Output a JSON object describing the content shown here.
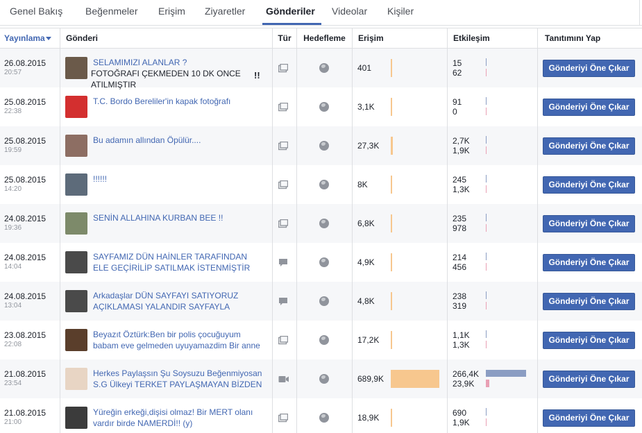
{
  "tabs": [
    "Genel Bakış",
    "Beğenmeler",
    "Erişim",
    "Ziyaretler",
    "Gönderiler",
    "Videolar",
    "Kişiler"
  ],
  "active_tab": "Gönderiler",
  "columns": {
    "published": "Yayınlama",
    "post": "Gönderi",
    "type": "Tür",
    "targeting": "Hedefleme",
    "reach": "Erişim",
    "engagement": "Etkileşim",
    "promote": "Tanıtımını Yap"
  },
  "promote_label": "Gönderiyi Öne Çıkar",
  "max_reach": 689900,
  "max_engagement": 266400,
  "colors": {
    "accent": "#4267b2",
    "reach_bar": "#f7c78e",
    "engagement_bar": "#8b9dc3",
    "reaction_bar": "#e9a0b4"
  },
  "posts": [
    {
      "date": "26.08.2015",
      "time": "20:57",
      "text": "SELAMIMIZI ALANLAR ?",
      "text_extra": "FOTOĞRAFI ÇEKMEDEN 10 DK ONCE\nATILMIŞTIR",
      "extra_mark": "!!",
      "type_icon": "photo-icon",
      "reach": "401",
      "reach_num": 401,
      "engagement": "15",
      "engagement_num": 15,
      "reactions": "62",
      "reactions_num": 62,
      "thumb": "#6b5a4a"
    },
    {
      "date": "25.08.2015",
      "time": "22:38",
      "text": "T.C. Bordo Bereliler'in kapak fotoğrafı",
      "type_icon": "photo-icon",
      "reach": "3,1K",
      "reach_num": 3100,
      "engagement": "91",
      "engagement_num": 91,
      "reactions": "0",
      "reactions_num": 0,
      "thumb": "#d32f2f"
    },
    {
      "date": "25.08.2015",
      "time": "19:59",
      "text": "Bu adamın allından Öpülür....",
      "type_icon": "photo-icon",
      "reach": "27,3K",
      "reach_num": 27300,
      "engagement": "2,7K",
      "engagement_num": 2700,
      "reactions": "1,9K",
      "reactions_num": 1900,
      "thumb": "#8d6e63"
    },
    {
      "date": "25.08.2015",
      "time": "14:20",
      "text": "!!!!!!",
      "type_icon": "photo-icon",
      "reach": "8K",
      "reach_num": 8000,
      "engagement": "245",
      "engagement_num": 245,
      "reactions": "1,3K",
      "reactions_num": 1300,
      "thumb": "#5d6b7a"
    },
    {
      "date": "24.08.2015",
      "time": "19:36",
      "text": "SENİN ALLAHINA KURBAN BEE !!",
      "type_icon": "photo-icon",
      "reach": "6,8K",
      "reach_num": 6800,
      "engagement": "235",
      "engagement_num": 235,
      "reactions": "978",
      "reactions_num": 978,
      "thumb": "#7d8a6a"
    },
    {
      "date": "24.08.2015",
      "time": "14:04",
      "text": "SAYFAMIZ DÜN HAİNLER TARAFINDAN\nELE GEÇİRİLİP SATILMAK İSTENMİŞTİR",
      "type_icon": "status-icon",
      "reach": "4,9K",
      "reach_num": 4900,
      "engagement": "214",
      "engagement_num": 214,
      "reactions": "456",
      "reactions_num": 456,
      "thumb": "#4a4a4a"
    },
    {
      "date": "24.08.2015",
      "time": "13:04",
      "text": "Arkadaşlar DÜN SAYFAYI SATIYORUZ\nAÇIKLAMASI YALANDIR SAYFAYLA",
      "type_icon": "status-icon",
      "reach": "4,8K",
      "reach_num": 4800,
      "engagement": "238",
      "engagement_num": 238,
      "reactions": "319",
      "reactions_num": 319,
      "thumb": "#4a4a4a"
    },
    {
      "date": "23.08.2015",
      "time": "22:08",
      "text": "Beyazıt Öztürk:Ben bir polis çocuğuyum\nbabam eve gelmeden uyuyamazdim Bir anne",
      "type_icon": "photo-icon",
      "reach": "17,2K",
      "reach_num": 17200,
      "engagement": "1,1K",
      "engagement_num": 1100,
      "reactions": "1,3K",
      "reactions_num": 1300,
      "thumb": "#5a3e2b"
    },
    {
      "date": "21.08.2015",
      "time": "23:54",
      "text": "Herkes Paylaşsın Şu Soysuzu Beğenmiyosan\nS.G Ülkeyi TERKET PAYLAŞMAYAN BİZDEN",
      "type_icon": "video-icon",
      "reach": "689,9K",
      "reach_num": 689900,
      "engagement": "266,4K",
      "engagement_num": 266400,
      "reactions": "23,9K",
      "reactions_num": 23900,
      "thumb": "#e8d5c4"
    },
    {
      "date": "21.08.2015",
      "time": "21:00",
      "text": "Yüreğin erkeği,dişisi olmaz! Bir MERT olanı\nvardır birde NAMERDİ!! (y)",
      "type_icon": "photo-icon",
      "reach": "18,9K",
      "reach_num": 18900,
      "engagement": "690",
      "engagement_num": 690,
      "reactions": "1,9K",
      "reactions_num": 1900,
      "thumb": "#3b3b3b"
    }
  ]
}
